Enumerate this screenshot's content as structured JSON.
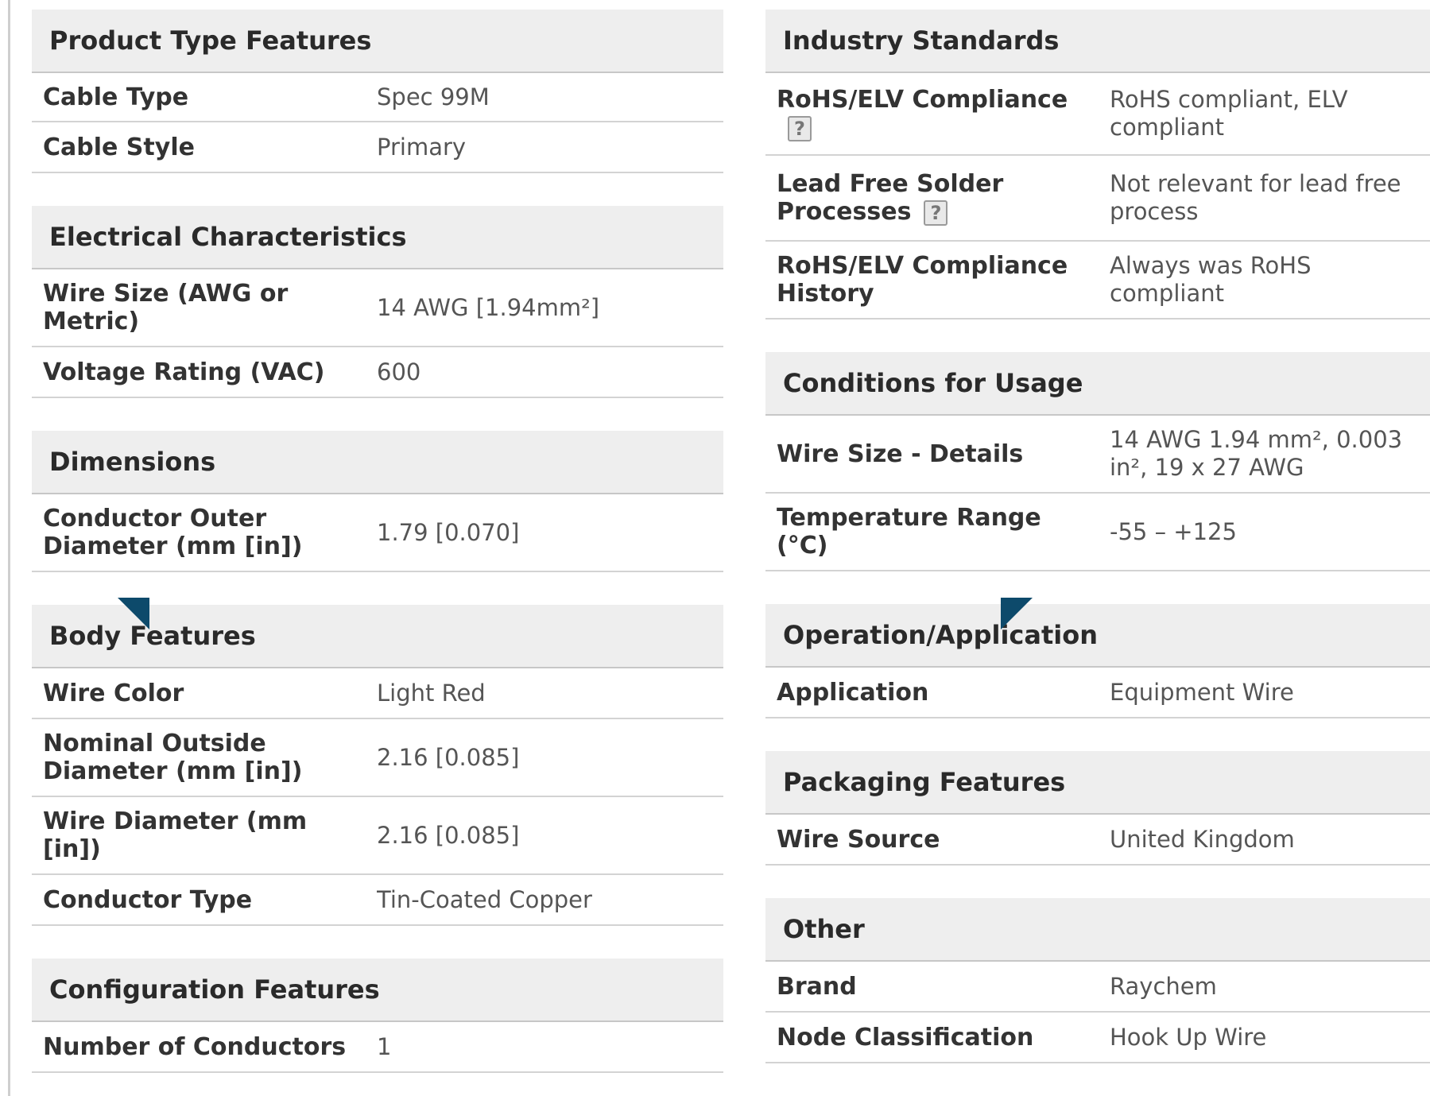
{
  "colors": {
    "header_bg": "#eeeeee",
    "marker": "#0d4a6b"
  },
  "left_sections": [
    {
      "title": "Product Type Features",
      "rows": [
        {
          "label": "Cable Type",
          "value": "Spec 99M"
        },
        {
          "label": "Cable Style",
          "value": "Primary"
        }
      ]
    },
    {
      "title": "Electrical Characteristics",
      "rows": [
        {
          "label": "Wire Size (AWG or\nMetric)",
          "value": "14 AWG [1.94mm²]"
        },
        {
          "label": "Voltage Rating (VAC)",
          "value": "600"
        }
      ]
    },
    {
      "title": "Dimensions",
      "rows": [
        {
          "label": "Conductor Outer\nDiameter (mm [in])",
          "value": "1.79 [0.070]"
        }
      ]
    },
    {
      "title": "Body Features",
      "rows": [
        {
          "label": "Wire Color",
          "value": "Light Red"
        },
        {
          "label": "Nominal Outside\nDiameter (mm [in])",
          "value": "2.16 [0.085]"
        },
        {
          "label": "Wire Diameter (mm\n[in])",
          "value": "2.16 [0.085]"
        },
        {
          "label": "Conductor Type",
          "value": "Tin-Coated Copper"
        }
      ]
    },
    {
      "title": "Configuration Features",
      "rows": [
        {
          "label": "Number of Conductors",
          "value": "1"
        }
      ]
    }
  ],
  "right_sections": [
    {
      "title": "Industry Standards",
      "rows": [
        {
          "label": "RoHS/ELV Compliance",
          "value": "RoHS compliant, ELV\ncompliant",
          "help": "?",
          "help_pos": "newline"
        },
        {
          "label": "Lead Free Solder\nProcesses",
          "value": "Not relevant for lead free\nprocess",
          "help": "?",
          "help_pos": "inline"
        },
        {
          "label": "RoHS/ELV Compliance\nHistory",
          "value": "Always was RoHS\ncompliant"
        }
      ]
    },
    {
      "title": "Conditions for Usage",
      "rows": [
        {
          "label": "Wire Size - Details",
          "value": "14 AWG 1.94 mm², 0.003\nin², 19 x 27 AWG"
        },
        {
          "label": "Temperature Range\n(°C)",
          "value": "-55 – +125"
        }
      ]
    },
    {
      "title": "Operation/Application",
      "rows": [
        {
          "label": "Application",
          "value": "Equipment Wire"
        }
      ]
    },
    {
      "title": "Packaging Features",
      "rows": [
        {
          "label": "Wire Source",
          "value": "United Kingdom"
        }
      ]
    },
    {
      "title": "Other",
      "rows": [
        {
          "label": "Brand",
          "value": "Raychem"
        },
        {
          "label": "Node Classification",
          "value": "Hook Up Wire"
        }
      ]
    }
  ]
}
